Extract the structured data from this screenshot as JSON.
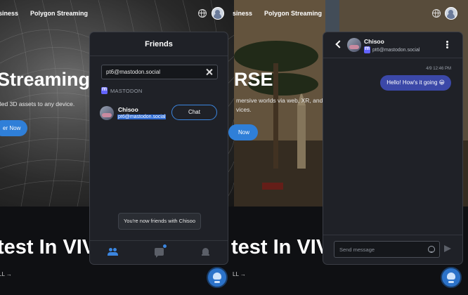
{
  "left_page": {
    "nav": {
      "business_fragment": "siness",
      "brand_link": "Polygon Streaming"
    },
    "hero": {
      "title_fragment": "Streaming",
      "subtitle_fragment": "iled 3D assets to any device.",
      "cta_fragment": "er Now"
    },
    "section": {
      "headline_fragment": "test In VIV",
      "link_fragment": "LL →"
    }
  },
  "right_page": {
    "nav": {
      "business_fragment": "siness",
      "brand_link": "Polygon Streaming"
    },
    "hero": {
      "title_fragment": "RSE",
      "subtitle_line1": "mersive worlds via web, XR, and",
      "subtitle_line2": "vices.",
      "cta_fragment": "Now"
    },
    "section": {
      "headline_fragment": "test In VIV",
      "link_fragment": "LL →"
    }
  },
  "friends_panel": {
    "title": "Friends",
    "search": {
      "value": "pt6@mastodon.social"
    },
    "network_label": "MASTODON",
    "result": {
      "name": "Chisoo",
      "handle": "pt6@mastodon.social",
      "chat_button": "Chat"
    },
    "toast": "You're now friends with Chisoo",
    "tabs": [
      "friends",
      "messages",
      "notifications"
    ]
  },
  "chat_panel": {
    "contact_name": "Chisoo",
    "contact_handle": "pt6@mastodon.social",
    "messages": [
      {
        "time": "4/9 12:46 PM",
        "text": "Hello! How's it going 😀",
        "outgoing": true
      }
    ],
    "input_placeholder": "Send message"
  },
  "colors": {
    "accent": "#3b86e0",
    "panel_bg": "#1f2127",
    "bubble": "#3b48a8",
    "mastodon": "#6364ff"
  }
}
